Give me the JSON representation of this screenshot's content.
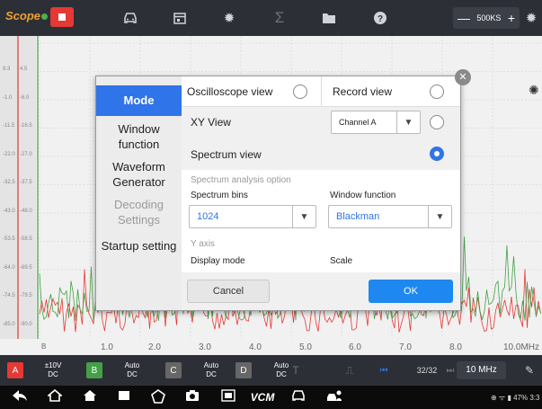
{
  "app": {
    "logo_text": "Scope"
  },
  "toolbar": {
    "icons": [
      "stop-icon",
      "car-icon",
      "calendar-icon",
      "gear-icon",
      "sigma-icon",
      "folder-icon",
      "help-icon",
      "settings-icon"
    ],
    "timebase_value": "500KS",
    "minus_label": "—",
    "plus_label": "+"
  },
  "plot": {
    "y_labels_a": [
      "9.3",
      "-1.0",
      "-11.5",
      "-22.0",
      "-32.5",
      "-43.0",
      "-53.5",
      "-64.0",
      "-74.5",
      "-85.0"
    ],
    "y_labels_b": [
      "4.5",
      "-6.0",
      "-16.5",
      "-27.0",
      "-37.5",
      "-48.0",
      "-58.5",
      "-69.5",
      "-79.5",
      "-90.0"
    ],
    "x_labels": [
      "1.0",
      "2.0",
      "3.0",
      "4.0",
      "5.0",
      "6.0",
      "7.0",
      "8.0",
      "10.0MHz"
    ],
    "x_start_label": "B"
  },
  "channels": [
    {
      "tag": "A",
      "range": "±10V",
      "coupling": "DC",
      "color": "#e53935"
    },
    {
      "tag": "B",
      "range": "Auto",
      "coupling": "DC",
      "color": "#43a047"
    },
    {
      "tag": "C",
      "range": "Auto",
      "coupling": "DC",
      "color": "#666666"
    },
    {
      "tag": "D",
      "range": "Auto",
      "coupling": "DC",
      "color": "#666666"
    }
  ],
  "channel_bar": {
    "page": "32/32",
    "frequency": "10 MHz"
  },
  "status_bar": {
    "text": "47% 3:3"
  },
  "dialog": {
    "sidebar": {
      "mode": "Mode",
      "window_function": "Window function",
      "waveform_generator": "Waveform Generator",
      "decoding_settings": "Decoding Settings",
      "startup_setting": "Startup setting"
    },
    "oscilloscope_view": "Oscilloscope view",
    "record_view": "Record view",
    "xy_view": "XY View",
    "xy_channel": "Channel A",
    "spectrum_view": "Spectrum view",
    "spectrum_option_label": "Spectrum analysis option",
    "spectrum_bins_label": "Spectrum bins",
    "spectrum_bins_value": "1024",
    "window_function_label": "Window function",
    "window_function_value": "Blackman",
    "y_axis_label": "Y axis",
    "display_mode_label": "Display mode",
    "scale_label": "Scale",
    "cancel": "Cancel",
    "ok": "OK",
    "selected_mode": "Spectrum view"
  },
  "navbar": {
    "icons": [
      "back-icon",
      "home-icon",
      "house-icon",
      "recents-icon",
      "vci-icon",
      "camera-icon",
      "screenshot-icon",
      "vcm-icon",
      "car-icon",
      "user-car-icon"
    ],
    "vcm_label": "VCM"
  }
}
